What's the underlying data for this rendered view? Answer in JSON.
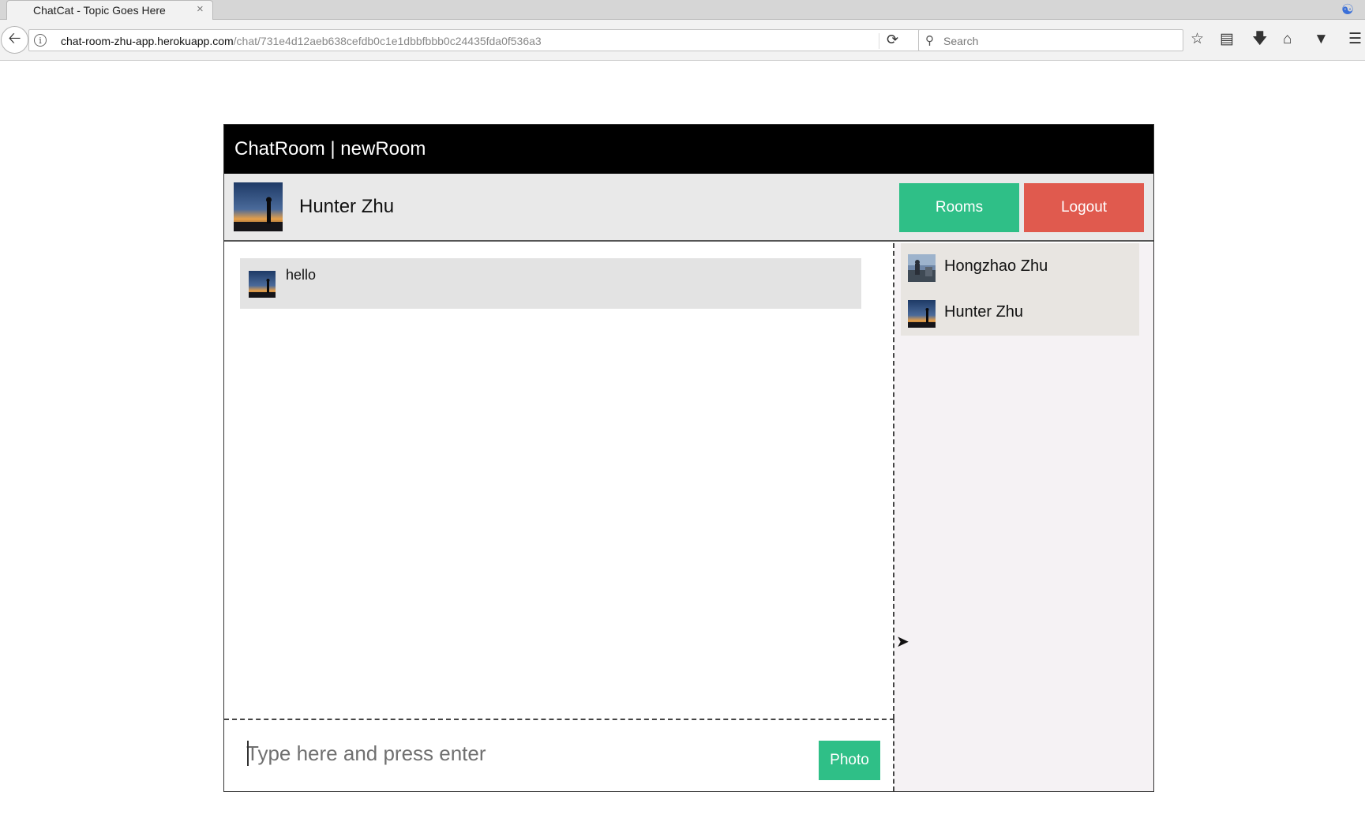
{
  "browser": {
    "tab_title": "ChatCat - Topic Goes Here",
    "tab_close": "×",
    "url_host": "chat-room-zhu-app.herokuapp.com",
    "url_path": "/chat/731e4d12aeb638cefdb0c1e1dbbfbbb0c24435fda0f536a3",
    "search_placeholder": "Search",
    "icons": [
      "back-arrow-icon",
      "info-icon",
      "reload-icon",
      "search-icon",
      "bookmark-star-icon",
      "reading-list-icon",
      "download-icon",
      "home-icon",
      "pocket-icon",
      "menu-icon"
    ]
  },
  "app": {
    "title": "ChatRoom | newRoom",
    "current_user": {
      "name": "Hunter Zhu"
    },
    "buttons": {
      "rooms": "Rooms",
      "logout": "Logout",
      "photo": "Photo"
    },
    "colors": {
      "header": "#000000",
      "rooms": "#2fbf87",
      "logout": "#e05a4e",
      "photo": "#2fbf87"
    },
    "messages": [
      {
        "text": "hello"
      }
    ],
    "compose_placeholder": "Type here and press enter",
    "users": [
      {
        "name": "Hongzhao Zhu"
      },
      {
        "name": "Hunter Zhu"
      }
    ]
  }
}
